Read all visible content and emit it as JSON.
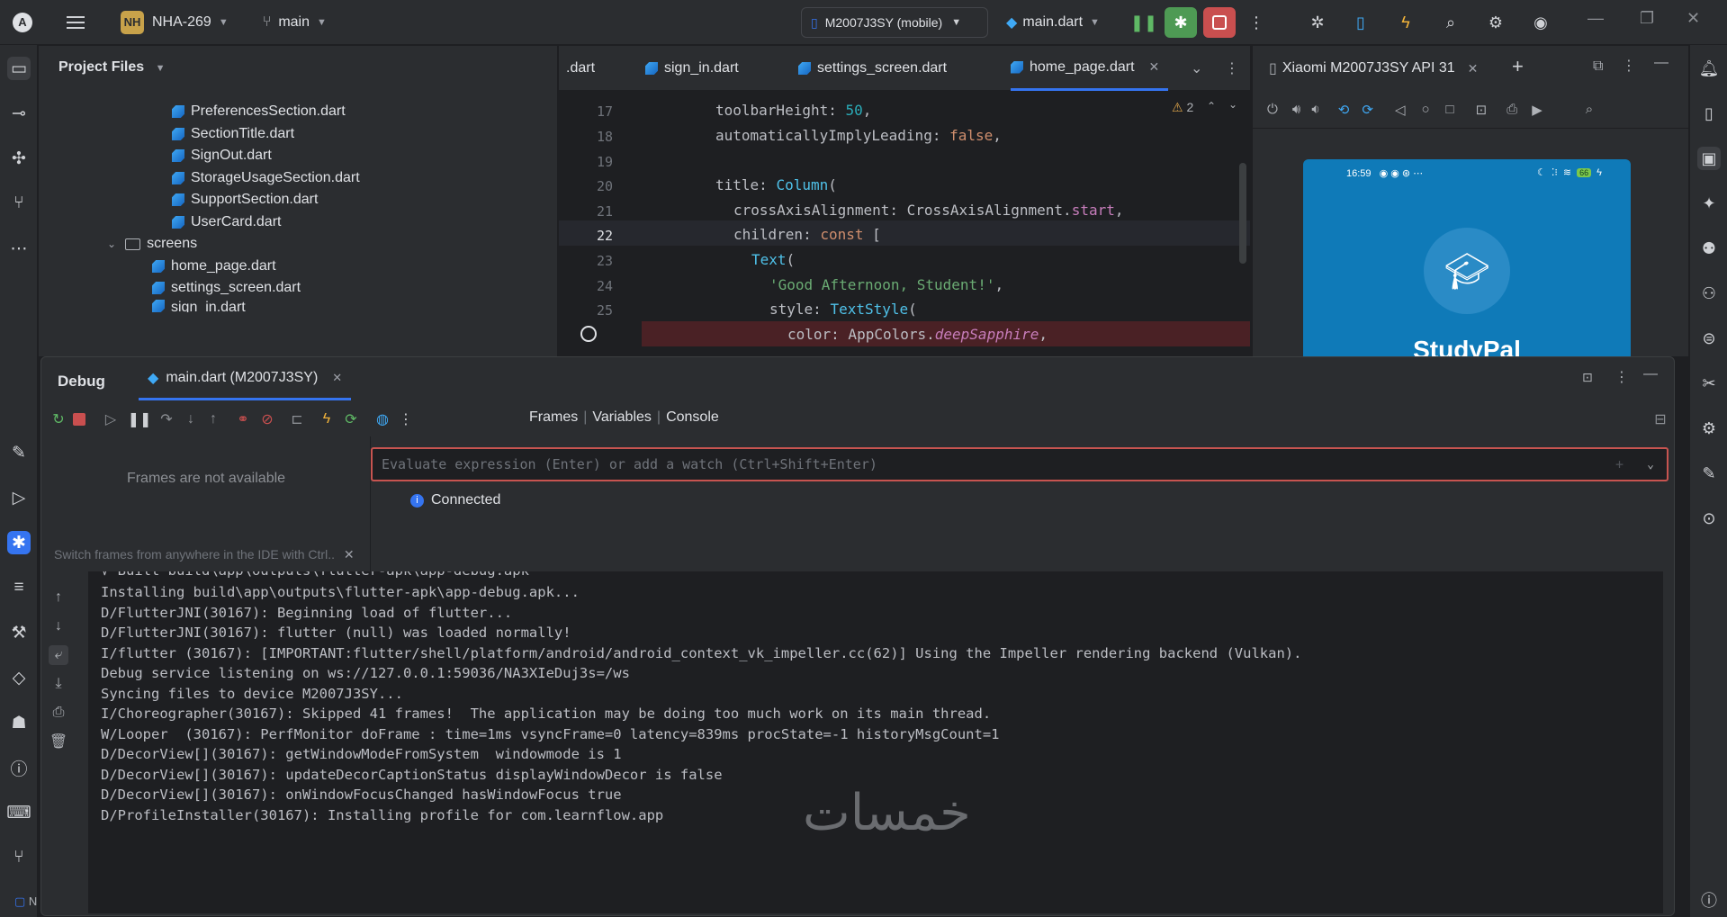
{
  "titlebar": {
    "project_badge": "NH",
    "project_name": "NHA-269",
    "branch": "main",
    "device": "M2007J3SY (mobile)",
    "run_config": "main.dart"
  },
  "project_panel": {
    "title": "Project Files",
    "items": [
      {
        "label": "PreferencesSection.dart",
        "type": "dart"
      },
      {
        "label": "SectionTitle.dart",
        "type": "dart"
      },
      {
        "label": "SignOut.dart",
        "type": "dart"
      },
      {
        "label": "StorageUsageSection.dart",
        "type": "dart"
      },
      {
        "label": "SupportSection.dart",
        "type": "dart"
      },
      {
        "label": "UserCard.dart",
        "type": "dart"
      },
      {
        "label": "screens",
        "type": "folder"
      },
      {
        "label": "home_page.dart",
        "type": "dart"
      },
      {
        "label": "settings_screen.dart",
        "type": "dart"
      },
      {
        "label": "sign_in.dart",
        "type": "dart"
      }
    ]
  },
  "editor": {
    "tabs": [
      ".dart",
      "sign_in.dart",
      "settings_screen.dart",
      "home_page.dart"
    ],
    "active_tab": "home_page.dart",
    "warning_count": "2",
    "lines": [
      {
        "num": "17",
        "text": "toolbarHeight: 50,"
      },
      {
        "num": "18",
        "text": "automaticallyImplyLeading: false,"
      },
      {
        "num": "19",
        "text": ""
      },
      {
        "num": "20",
        "text": "title: Column("
      },
      {
        "num": "21",
        "text": "crossAxisAlignment: CrossAxisAlignment.start,"
      },
      {
        "num": "22",
        "text": "children: const ["
      },
      {
        "num": "23",
        "text": "Text("
      },
      {
        "num": "24",
        "text": "'Good Afternoon, Student!',"
      },
      {
        "num": "25",
        "text": "style: TextStyle("
      },
      {
        "num": "",
        "text": "color: AppColors.deepSapphire,"
      }
    ]
  },
  "emulator": {
    "title": "Xiaomi M2007J3SY API 31",
    "status_time": "16:59",
    "battery": "66",
    "app_name": "StudyPal"
  },
  "debug": {
    "title": "Debug",
    "session_tab": "main.dart (M2007J3SY)",
    "views": [
      "Frames",
      "Variables",
      "Console"
    ],
    "frames_empty": "Frames are not available",
    "frames_hint": "Switch frames from anywhere in the IDE with Ctrl..",
    "eval_placeholder": "Evaluate expression (Enter) or add a watch (Ctrl+Shift+Enter)",
    "status": "Connected",
    "console_lines": [
      "√ Built build\\app\\outputs\\flutter-apk\\app-debug.apk",
      "Installing build\\app\\outputs\\flutter-apk\\app-debug.apk...",
      "D/FlutterJNI(30167): Beginning load of flutter...",
      "D/FlutterJNI(30167): flutter (null) was loaded normally!",
      "I/flutter (30167): [IMPORTANT:flutter/shell/platform/android/android_context_vk_impeller.cc(62)] Using the Impeller rendering backend (Vulkan).",
      "Debug service listening on ws://127.0.0.1:59036/NA3XIeDuj3s=/ws",
      "Syncing files to device M2007J3SY...",
      "I/Choreographer(30167): Skipped 41 frames!  The application may be doing too much work on its main thread.",
      "W/Looper  (30167): PerfMonitor doFrame : time=1ms vsyncFrame=0 latency=839ms procState=-1 historyMsgCount=1",
      "D/DecorView[](30167): getWindowModeFromSystem  windowmode is 1",
      "D/DecorView[](30167): updateDecorCaptionStatus displayWindowDecor is false",
      "D/DecorView[](30167): onWindowFocusChanged hasWindowFocus true",
      "D/ProfileInstaller(30167): Installing profile for com.learnflow.app"
    ],
    "watermark": "خمسات"
  },
  "colors": {
    "accent": "#3574f0",
    "error_border": "#c75450",
    "phone_bg": "#0f7ab8"
  }
}
